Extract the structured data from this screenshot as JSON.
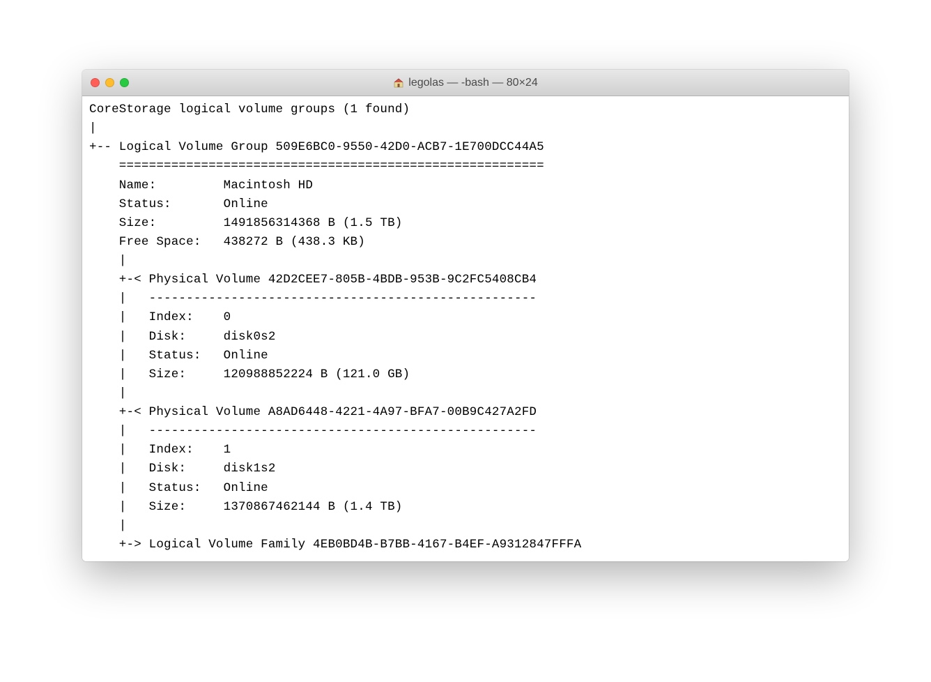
{
  "window": {
    "title": "legolas — -bash — 80×24"
  },
  "terminal": {
    "lines": [
      "CoreStorage logical volume groups (1 found)",
      "|",
      "+-- Logical Volume Group 509E6BC0-9550-42D0-ACB7-1E700DCC44A5",
      "    =========================================================",
      "    Name:         Macintosh HD",
      "    Status:       Online",
      "    Size:         1491856314368 B (1.5 TB)",
      "    Free Space:   438272 B (438.3 KB)",
      "    |",
      "    +-< Physical Volume 42D2CEE7-805B-4BDB-953B-9C2FC5408CB4",
      "    |   ----------------------------------------------------",
      "    |   Index:    0",
      "    |   Disk:     disk0s2",
      "    |   Status:   Online",
      "    |   Size:     120988852224 B (121.0 GB)",
      "    |",
      "    +-< Physical Volume A8AD6448-4221-4A97-BFA7-00B9C427A2FD",
      "    |   ----------------------------------------------------",
      "    |   Index:    1",
      "    |   Disk:     disk1s2",
      "    |   Status:   Online",
      "    |   Size:     1370867462144 B (1.4 TB)",
      "    |",
      "    +-> Logical Volume Family 4EB0BD4B-B7BB-4167-B4EF-A9312847FFFA"
    ]
  }
}
